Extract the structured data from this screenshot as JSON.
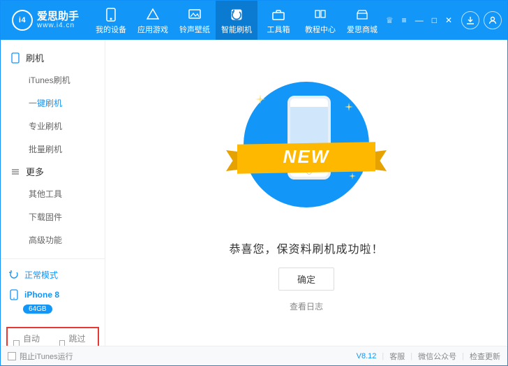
{
  "brand": {
    "cn": "爱思助手",
    "site": "www.i4.cn",
    "logo_text": "i4"
  },
  "win_controls": {
    "gift": "♕",
    "menu": "≡",
    "min": "—",
    "max": "□",
    "close": "✕"
  },
  "nav": {
    "items": [
      {
        "label": "我的设备",
        "icon": "device"
      },
      {
        "label": "应用游戏",
        "icon": "apps"
      },
      {
        "label": "铃声壁纸",
        "icon": "media"
      },
      {
        "label": "智能刷机",
        "icon": "flash"
      },
      {
        "label": "工具箱",
        "icon": "toolbox"
      },
      {
        "label": "教程中心",
        "icon": "help"
      },
      {
        "label": "爱思商城",
        "icon": "store"
      }
    ],
    "active_index": 3
  },
  "sidebar": {
    "sections": [
      {
        "title": "刷机",
        "items": [
          "iTunes刷机",
          "一键刷机",
          "专业刷机",
          "批量刷机"
        ],
        "active_index": 1
      },
      {
        "title": "更多",
        "items": [
          "其他工具",
          "下载固件",
          "高级功能"
        ],
        "active_index": -1
      }
    ],
    "mode": {
      "label": "正常模式"
    },
    "device": {
      "name": "iPhone 8",
      "storage": "64GB"
    },
    "options": {
      "auto_activate": "自动激活",
      "skip_guide": "跳过向导"
    }
  },
  "main": {
    "ribbon_text": "NEW",
    "success_text": "恭喜您，保资料刷机成功啦！",
    "ok_button": "确定",
    "log_link": "查看日志"
  },
  "statusbar": {
    "block_itunes": "阻止iTunes运行",
    "version": "V8.12",
    "support": "客服",
    "wechat": "微信公众号",
    "check_update": "检查更新"
  }
}
